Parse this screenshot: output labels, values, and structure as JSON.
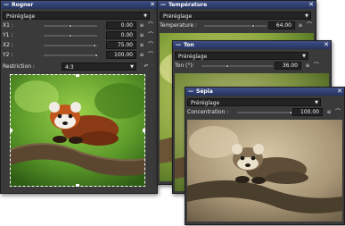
{
  "panels": {
    "rogner": {
      "title": "Rogner",
      "preset": "Préréglage",
      "sliders": [
        {
          "label": "X1 :",
          "value": "0.00",
          "level": 0.0
        },
        {
          "label": "Y1 :",
          "value": "0.00",
          "level": 0.0
        },
        {
          "label": "X2 :",
          "value": "75.00",
          "level": 0.75
        },
        {
          "label": "Y2 :",
          "value": "100.00",
          "level": 1.0
        }
      ],
      "restriction_label": "Restriction :",
      "restriction_value": "4:3"
    },
    "temperature": {
      "title": "Température",
      "preset": "Préréglage",
      "slider": {
        "label": "Temperature :",
        "value": "64.00",
        "level": 0.64
      }
    },
    "ton": {
      "title": "Ton",
      "preset": "Préréglage",
      "slider": {
        "label": "Ton (°):",
        "value": "36.00",
        "level": 0.36
      }
    },
    "sepia": {
      "title": "Sépia",
      "preset": "Préréglage",
      "slider": {
        "label": "Concentration :",
        "value": "100.00",
        "level": 1.0
      }
    }
  },
  "colors": {
    "titlebar": "#2f3d6e",
    "panel_bg": "#3a3a3a",
    "field_bg": "#232323"
  },
  "icons": [
    "dash-icon",
    "close-icon",
    "chevron-down-icon",
    "hamburger-menu-icon",
    "curve-icon",
    "undo-icon"
  ]
}
